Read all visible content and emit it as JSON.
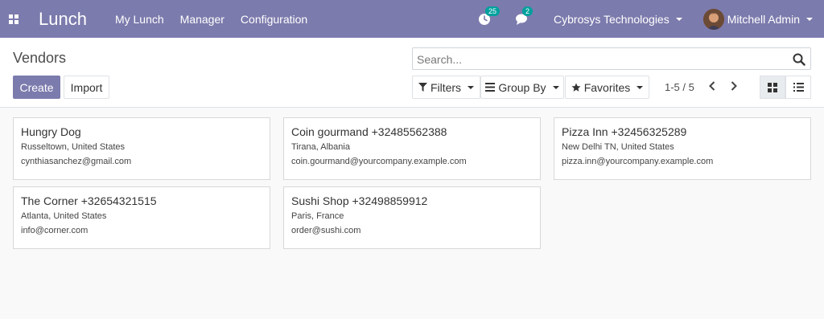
{
  "navbar": {
    "brand": "Lunch",
    "menu": [
      "My Lunch",
      "Manager",
      "Configuration"
    ],
    "activity_count": "25",
    "message_count": "2",
    "company": "Cybrosys Technologies",
    "user": "Mitchell Admin",
    "color": "#7c7bad"
  },
  "control_panel": {
    "breadcrumb": "Vendors",
    "create_label": "Create",
    "import_label": "Import",
    "search_placeholder": "Search...",
    "filters_label": "Filters",
    "groupby_label": "Group By",
    "favorites_label": "Favorites",
    "pager": "1-5 / 5"
  },
  "vendors": [
    {
      "title": "Hungry Dog",
      "location": "Russeltown, United States",
      "email": "cynthiasanchez@gmail.com"
    },
    {
      "title": "Coin gourmand +32485562388",
      "location": "Tirana, Albania",
      "email": "coin.gourmand@yourcompany.example.com"
    },
    {
      "title": "Pizza Inn +32456325289",
      "location": "New Delhi TN, United States",
      "email": "pizza.inn@yourcompany.example.com"
    },
    {
      "title": "The Corner +32654321515",
      "location": "Atlanta, United States",
      "email": "info@corner.com"
    },
    {
      "title": "Sushi Shop +32498859912",
      "location": "Paris, France",
      "email": "order@sushi.com"
    }
  ]
}
